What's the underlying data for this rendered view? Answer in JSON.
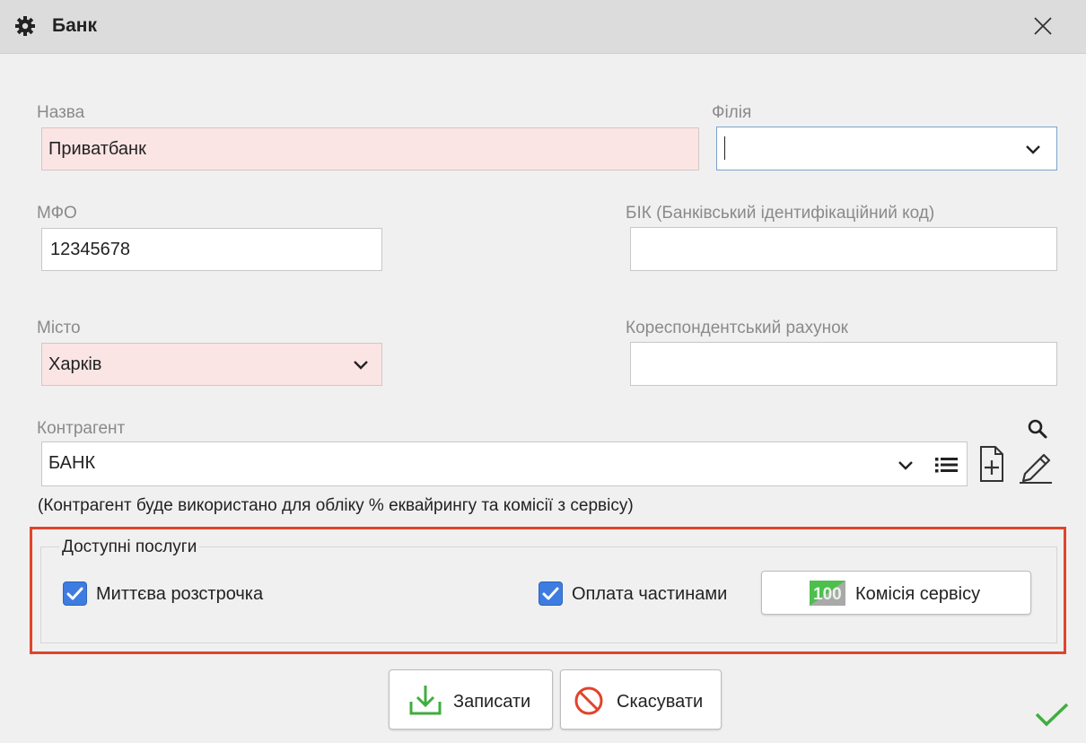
{
  "window": {
    "title": "Банк",
    "icon": "gear-icon",
    "close_icon": "close-icon"
  },
  "form": {
    "name": {
      "label": "Назва",
      "value": "Приватбанк"
    },
    "branch": {
      "label": "Філія",
      "value": ""
    },
    "mfo": {
      "label": "МФО",
      "value": "12345678"
    },
    "bic": {
      "label": "БІК (Банківський ідентифікаційний код)",
      "value": ""
    },
    "city": {
      "label": "Місто",
      "value": "Харків"
    },
    "corr_account": {
      "label": "Кореспондентський рахунок",
      "value": ""
    },
    "counterparty": {
      "label": "Контрагент",
      "value": "БАНК"
    },
    "note": "(Контрагент буде використано для обліку % еквайрингу та комісії з сервісу)"
  },
  "services": {
    "title": "Доступні послуги",
    "instant_installment": {
      "label": "Миттєва розстрочка",
      "checked": true
    },
    "pay_in_parts": {
      "label": "Оплата частинами",
      "checked": true
    },
    "commission_button": "Комісія сервісу"
  },
  "buttons": {
    "save": "Записати",
    "cancel": "Скасувати"
  },
  "colors": {
    "accent": "#3e7ce0",
    "required_bg": "#fbe4e4",
    "highlight": "#e0442c",
    "save_green": "#3fae3f",
    "cancel_red": "#e0442c"
  }
}
